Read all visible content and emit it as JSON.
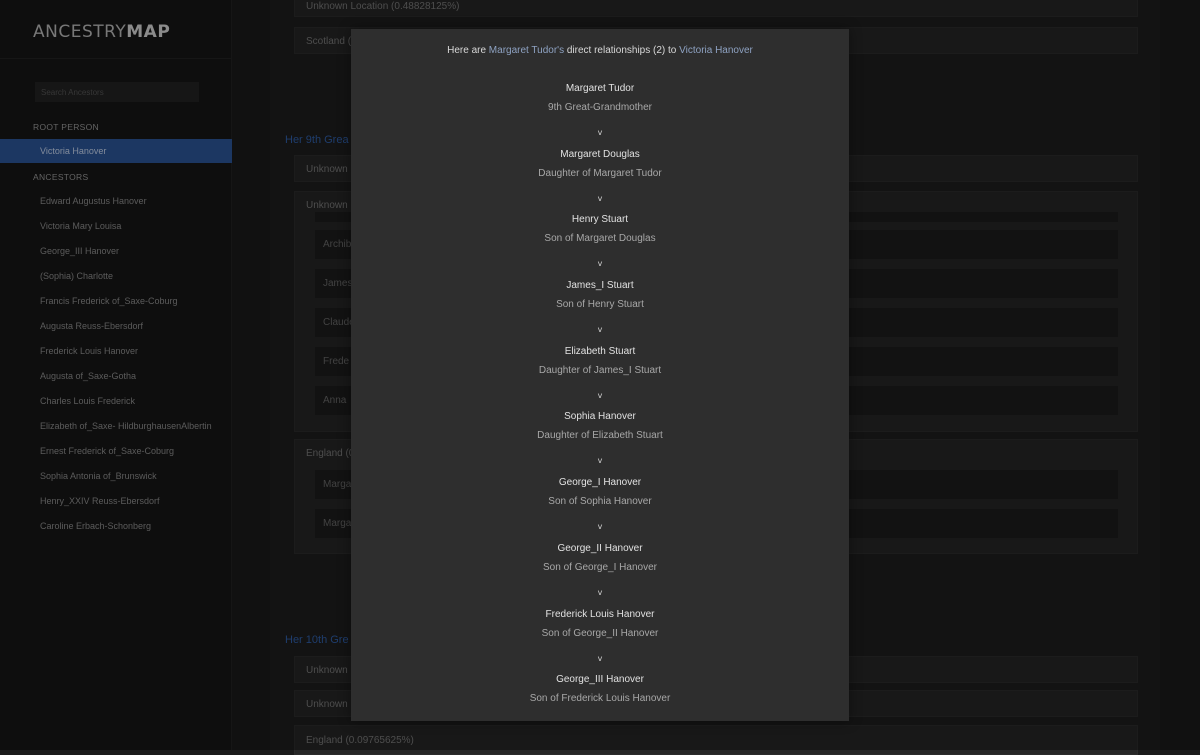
{
  "app": {
    "logo_light": "ANCESTRY",
    "logo_bold": "MAP"
  },
  "sidebar": {
    "search_placeholder": "Search Ancestors",
    "root_heading": "ROOT PERSON",
    "root_person": "Victoria Hanover",
    "ancestors_heading": "ANCESTORS",
    "ancestors": [
      "Edward Augustus Hanover",
      "Victoria Mary Louisa",
      "George_III Hanover",
      "(Sophia) Charlotte",
      "Francis Frederick of_Saxe-Coburg",
      "Augusta Reuss-Ebersdorf",
      "Frederick Louis Hanover",
      "Augusta of_Saxe-Gotha",
      "Charles Louis Frederick",
      "Elizabeth of_Saxe- HildburghausenAlbertin",
      "Ernest Frederick of_Saxe-Coburg",
      "Sophia Antonia of_Brunswick",
      "Henry_XXIV Reuss-Ebersdorf",
      "Caroline Erbach-Schonberg"
    ]
  },
  "main": {
    "card_unknown_location_top": "Unknown Location (0.48828125%)",
    "card_scotland": "Scotland (",
    "heading_9th": "Her 9th Grea",
    "card_unknown_a": "Unknown",
    "card_unknown_b": "Unknown",
    "inner_rows": [
      "Archib",
      "James",
      "Claude",
      "Frede",
      "Anna"
    ],
    "card_england": "England (0",
    "inner_rows_2": [
      "Marga",
      "Marga"
    ],
    "heading_10th": "Her 10th Gre",
    "card_unknown_c": "Unknown",
    "card_unknown_d": "Unknown",
    "card_england_bottom": "England (0.09765625%)"
  },
  "modal": {
    "title_prefix": "Here are ",
    "title_person": "Margaret Tudor's",
    "title_middle": " direct relationships (2) to ",
    "title_target": "Victoria Hanover",
    "arrow": "v",
    "chain": [
      {
        "name": "Margaret Tudor",
        "relation": "9th Great-Grandmother"
      },
      {
        "name": "Margaret Douglas",
        "relation": "Daughter of Margaret Tudor"
      },
      {
        "name": "Henry Stuart",
        "relation": "Son of Margaret Douglas"
      },
      {
        "name": "James_I Stuart",
        "relation": "Son of Henry Stuart"
      },
      {
        "name": "Elizabeth Stuart",
        "relation": "Daughter of James_I Stuart"
      },
      {
        "name": "Sophia Hanover",
        "relation": "Daughter of Elizabeth Stuart"
      },
      {
        "name": "George_I Hanover",
        "relation": "Son of Sophia Hanover"
      },
      {
        "name": "George_II Hanover",
        "relation": "Son of George_I Hanover"
      },
      {
        "name": "Frederick Louis Hanover",
        "relation": "Son of George_II Hanover"
      },
      {
        "name": "George_III Hanover",
        "relation": "Son of Frederick Louis Hanover"
      }
    ]
  }
}
